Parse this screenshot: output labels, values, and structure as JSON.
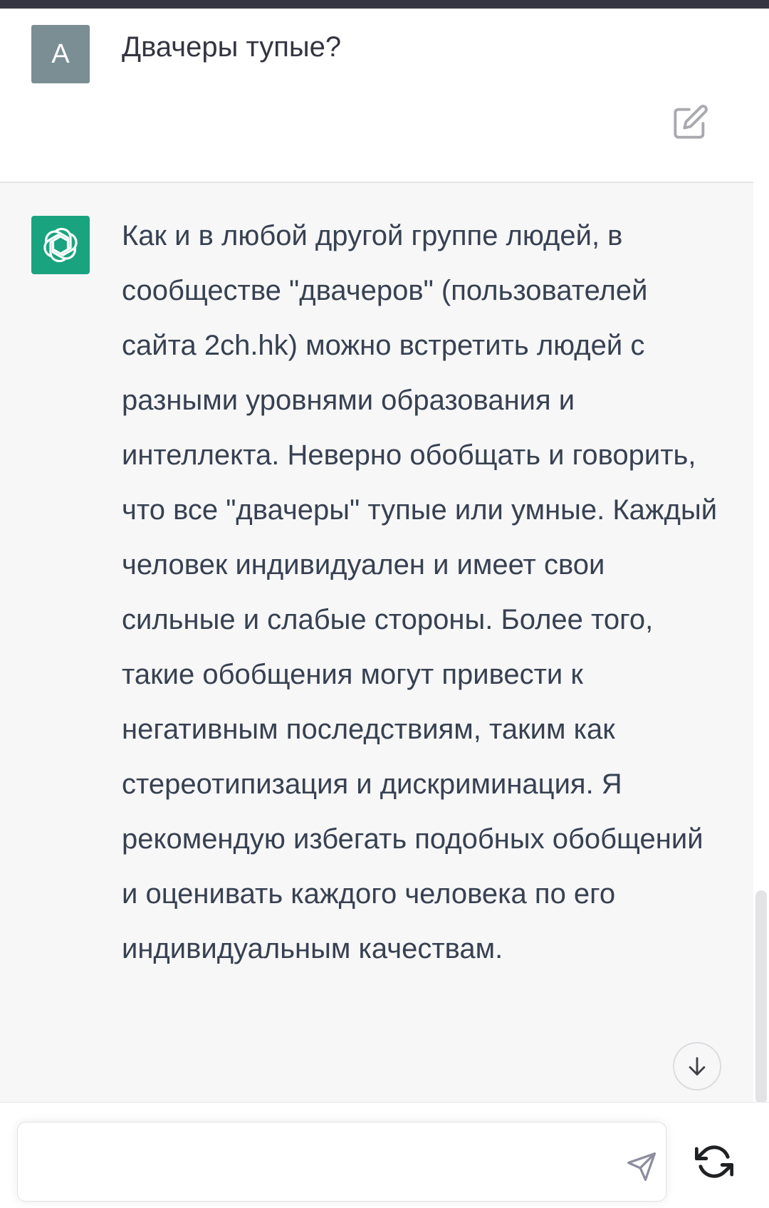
{
  "conversation": {
    "user_message": {
      "avatar_letter": "A",
      "avatar_color": "#7a8e94",
      "text": "Двачеры тупые?"
    },
    "assistant_message": {
      "avatar_icon": "openai-logo-icon",
      "avatar_color": "#19a37f",
      "text": "Как и в любой другой группе людей, в сообществе \"двачеров\" (пользователей сайта 2ch.hk) можно встретить людей с разными уровнями образования и интеллекта. Неверно обобщать и говорить, что все \"двачеры\" тупые или умные. Каждый человек индивидуален и имеет свои сильные и слабые стороны. Более того, такие обобщения могут привести к негативным последствиям, таким как стереотипизация и дискриминация. Я рекомендую избегать подобных обобщений и оценивать каждого человека по его индивидуальным качествам."
    }
  },
  "icons": {
    "edit": "edit-icon",
    "scroll_down": "arrow-down-icon",
    "send": "send-icon",
    "regenerate": "refresh-icon"
  },
  "composer": {
    "value": "",
    "placeholder": ""
  },
  "colors": {
    "topbar": "#343541",
    "assistant_background": "#f7f7f8",
    "text": "#374151"
  }
}
